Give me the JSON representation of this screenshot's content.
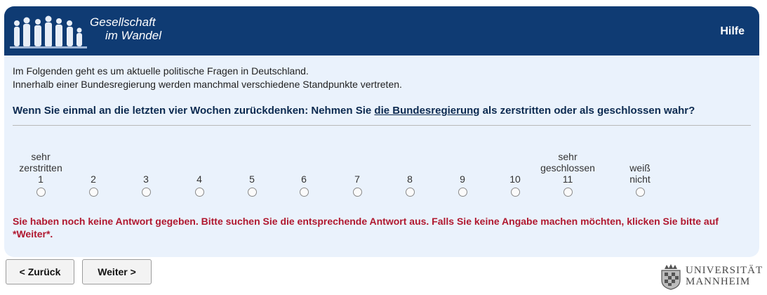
{
  "header": {
    "logo_line1": "Gesellschaft",
    "logo_line2": "im Wandel",
    "help_label": "Hilfe",
    "color": "#0f3b73"
  },
  "intro": {
    "line1": "Im Folgenden geht es um aktuelle politische Fragen in Deutschland.",
    "line2": "Innerhalb einer Bundesregierung werden manchmal verschiedene Standpunkte vertreten."
  },
  "question": {
    "before": "Wenn Sie einmal an die letzten vier Wochen zurückdenken: Nehmen Sie ",
    "link": "die Bundesregierung",
    "after": " als zerstritten oder als geschlossen wahr?"
  },
  "scale": {
    "options": [
      {
        "top1": "sehr",
        "top2": "zerstritten",
        "num": "1"
      },
      {
        "top1": "",
        "top2": "",
        "num": "2"
      },
      {
        "top1": "",
        "top2": "",
        "num": "3"
      },
      {
        "top1": "",
        "top2": "",
        "num": "4"
      },
      {
        "top1": "",
        "top2": "",
        "num": "5"
      },
      {
        "top1": "",
        "top2": "",
        "num": "6"
      },
      {
        "top1": "",
        "top2": "",
        "num": "7"
      },
      {
        "top1": "",
        "top2": "",
        "num": "8"
      },
      {
        "top1": "",
        "top2": "",
        "num": "9"
      },
      {
        "top1": "",
        "top2": "",
        "num": "10"
      },
      {
        "top1": "sehr",
        "top2": "geschlossen",
        "num": "11"
      },
      {
        "top1": "",
        "top2": "weiß",
        "num": "nicht"
      }
    ]
  },
  "error": {
    "text": "Sie haben noch keine Antwort gegeben. Bitte suchen Sie die entsprechende Antwort aus. Falls Sie keine Angabe machen möchten, klicken Sie bitte auf *Weiter*.",
    "color": "#b0182f"
  },
  "nav": {
    "back_label": "< Zurück",
    "next_label": "Weiter >"
  },
  "university": {
    "line1": "UNIVERSITÄT",
    "line2": "MANNHEIM"
  }
}
